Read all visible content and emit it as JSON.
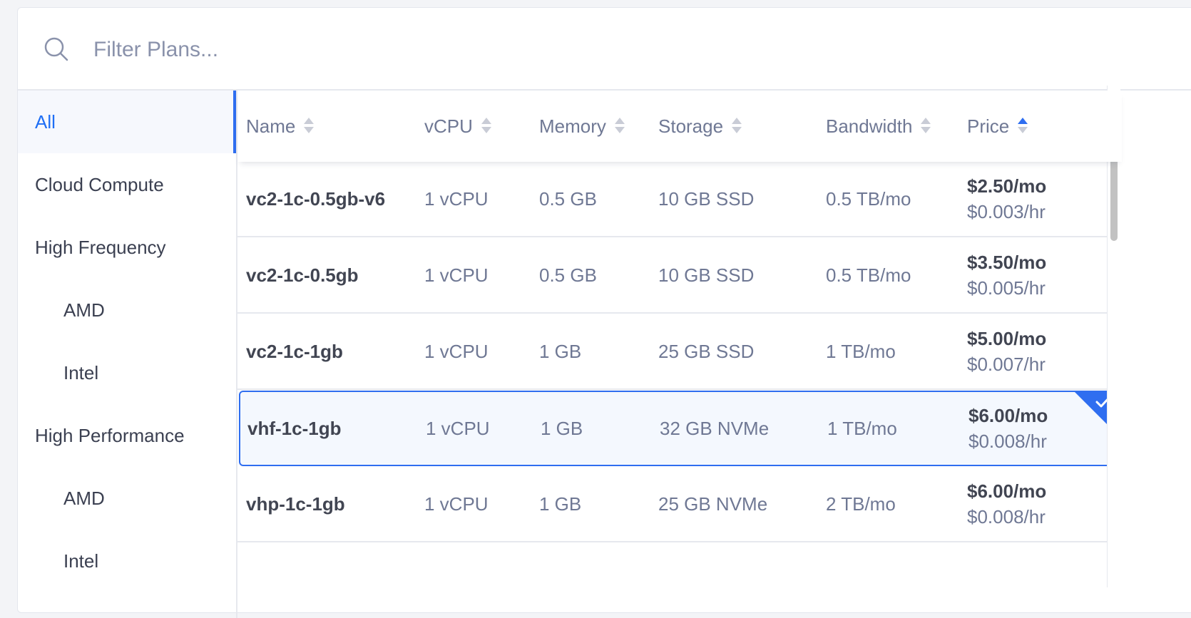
{
  "search": {
    "placeholder": "Filter Plans..."
  },
  "sidebar": {
    "items": [
      {
        "label": "All",
        "active": true,
        "sub": false
      },
      {
        "label": "Cloud Compute",
        "active": false,
        "sub": false
      },
      {
        "label": "High Frequency",
        "active": false,
        "sub": false
      },
      {
        "label": "AMD",
        "active": false,
        "sub": true
      },
      {
        "label": "Intel",
        "active": false,
        "sub": true
      },
      {
        "label": "High Performance",
        "active": false,
        "sub": false
      },
      {
        "label": "AMD",
        "active": false,
        "sub": true
      },
      {
        "label": "Intel",
        "active": false,
        "sub": true
      }
    ]
  },
  "table": {
    "columns": [
      "Name",
      "vCPU",
      "Memory",
      "Storage",
      "Bandwidth",
      "Price"
    ],
    "sorted_column": "Price",
    "sort_direction": "ascending",
    "rows": [
      {
        "name": "vc2-1c-0.5gb-v6",
        "vcpu": "1 vCPU",
        "memory": "0.5 GB",
        "storage": "10 GB SSD",
        "bandwidth": "0.5 TB/mo",
        "price_mo": "$2.50/mo",
        "price_hr": "$0.003/hr",
        "selected": false
      },
      {
        "name": "vc2-1c-0.5gb",
        "vcpu": "1 vCPU",
        "memory": "0.5 GB",
        "storage": "10 GB SSD",
        "bandwidth": "0.5 TB/mo",
        "price_mo": "$3.50/mo",
        "price_hr": "$0.005/hr",
        "selected": false
      },
      {
        "name": "vc2-1c-1gb",
        "vcpu": "1 vCPU",
        "memory": "1 GB",
        "storage": "25 GB SSD",
        "bandwidth": "1 TB/mo",
        "price_mo": "$5.00/mo",
        "price_hr": "$0.007/hr",
        "selected": false
      },
      {
        "name": "vhf-1c-1gb",
        "vcpu": "1 vCPU",
        "memory": "1 GB",
        "storage": "32 GB NVMe",
        "bandwidth": "1 TB/mo",
        "price_mo": "$6.00/mo",
        "price_hr": "$0.008/hr",
        "selected": true
      },
      {
        "name": "vhp-1c-1gb",
        "vcpu": "1 vCPU",
        "memory": "1 GB",
        "storage": "25 GB NVMe",
        "bandwidth": "2 TB/mo",
        "price_mo": "$6.00/mo",
        "price_hr": "$0.008/hr",
        "selected": false
      }
    ]
  },
  "colors": {
    "accent": "#2f6ef0",
    "active_text": "#1f6ff5",
    "selected_row_bg": "#f4f8fe",
    "muted_text": "#6f7894",
    "strong_text": "#414552"
  },
  "icons": {
    "search": "search-icon",
    "sort": "sort-arrows-icon",
    "selected": "check-icon"
  }
}
